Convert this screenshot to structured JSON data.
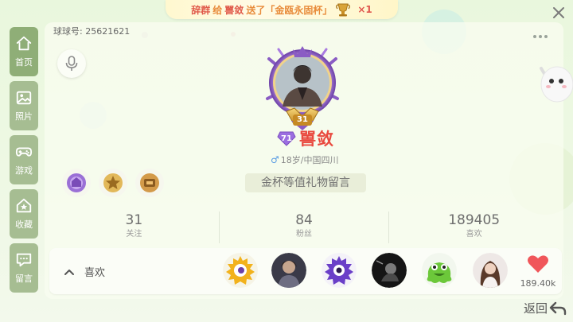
{
  "gift_banner": {
    "sender": "辞群",
    "give_word": "给",
    "receiver": "嘼敛",
    "sent_text": "送了「金瓯永固杯」",
    "count": "×1"
  },
  "profile": {
    "uid_text": "球球号: 25621621",
    "username": "嘼敛",
    "vip_level": "71",
    "level": "31",
    "age_location": "18岁/中国四川",
    "message_button": "金杯等值礼物留言"
  },
  "sidebar": {
    "items": [
      {
        "label": "首页",
        "icon": "home-icon"
      },
      {
        "label": "照片",
        "icon": "photo-icon"
      },
      {
        "label": "游戏",
        "icon": "gamepad-icon"
      },
      {
        "label": "收藏",
        "icon": "star-house-icon"
      },
      {
        "label": "留言",
        "icon": "chat-icon"
      }
    ]
  },
  "stats": [
    {
      "value": "31",
      "label": "关注"
    },
    {
      "value": "84",
      "label": "粉丝"
    },
    {
      "value": "189405",
      "label": "喜欢"
    }
  ],
  "likes": {
    "label": "喜欢",
    "count": "189.40k"
  },
  "back_label": "返回",
  "colors": {
    "accent_red": "#e94a3f",
    "sidebar_green": "#a6bd92",
    "background": "#e9f7dd"
  }
}
